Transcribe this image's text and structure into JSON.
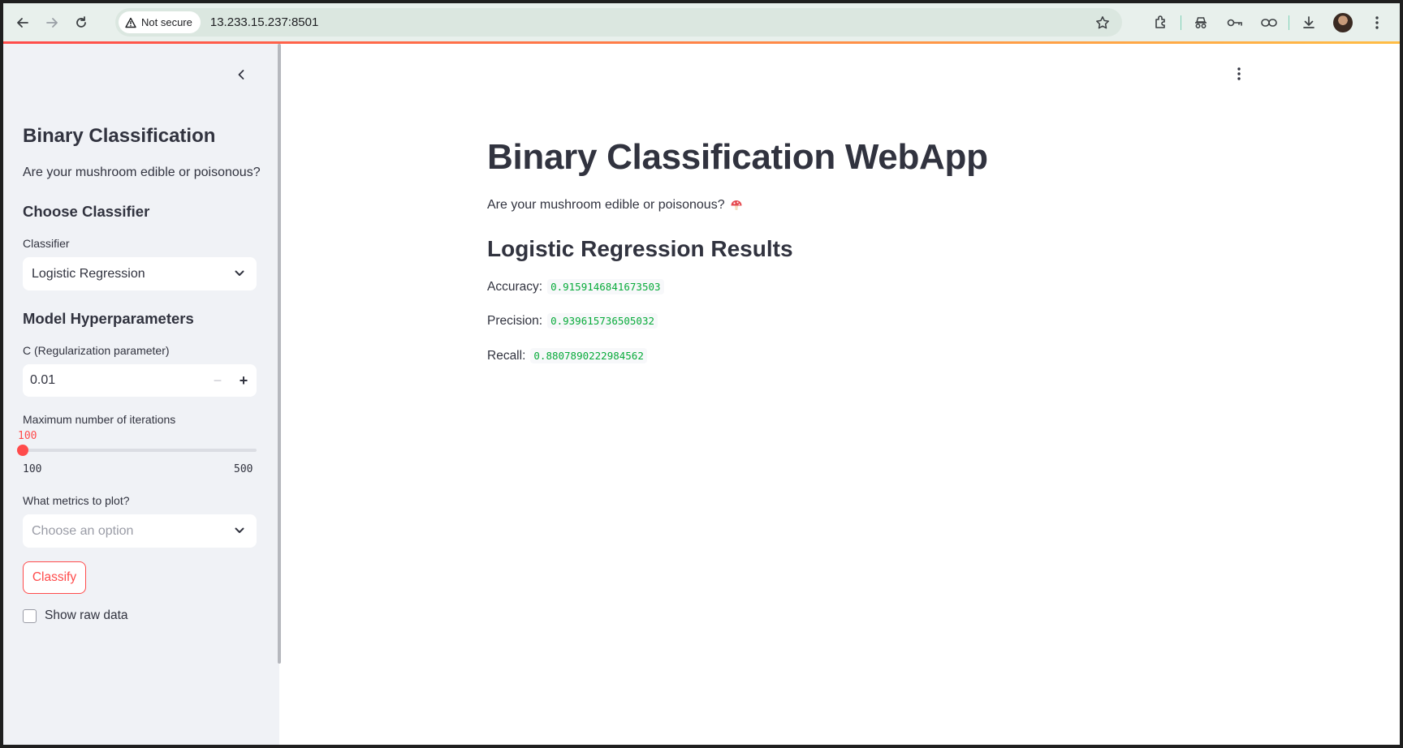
{
  "browser": {
    "security_label": "Not secure",
    "url": "13.233.15.237:8501"
  },
  "sidebar": {
    "title": "Binary Classification",
    "subtitle": "Are your mushroom edible or poisonous?",
    "choose_classifier_heading": "Choose Classifier",
    "classifier_label": "Classifier",
    "classifier_value": "Logistic Regression",
    "hyperparams_heading": "Model Hyperparameters",
    "c_label": "C (Regularization parameter)",
    "c_value": "0.01",
    "c_minus": "−",
    "c_plus": "+",
    "max_iter_label": "Maximum number of iterations",
    "max_iter": {
      "current": "100",
      "min": "100",
      "max": "500",
      "fraction": 0.0
    },
    "metrics_label": "What metrics to plot?",
    "metrics_placeholder": "Choose an option",
    "classify_button": "Classify",
    "show_raw_data_label": "Show raw data"
  },
  "main": {
    "title": "Binary Classification WebApp",
    "subtitle": "Are your mushroom edible or poisonous?",
    "subtitle_emoji": "🍄",
    "results_heading": "Logistic Regression Results",
    "metrics": [
      {
        "label": "Accuracy:",
        "value": "0.9159146841673503"
      },
      {
        "label": "Precision:",
        "value": "0.939615736505032"
      },
      {
        "label": "Recall:",
        "value": "0.8807890222984562"
      }
    ]
  },
  "colors": {
    "accent": "#ff4b4b",
    "sidebar_bg": "#f0f2f6",
    "metric_value": "#09ab3b"
  }
}
